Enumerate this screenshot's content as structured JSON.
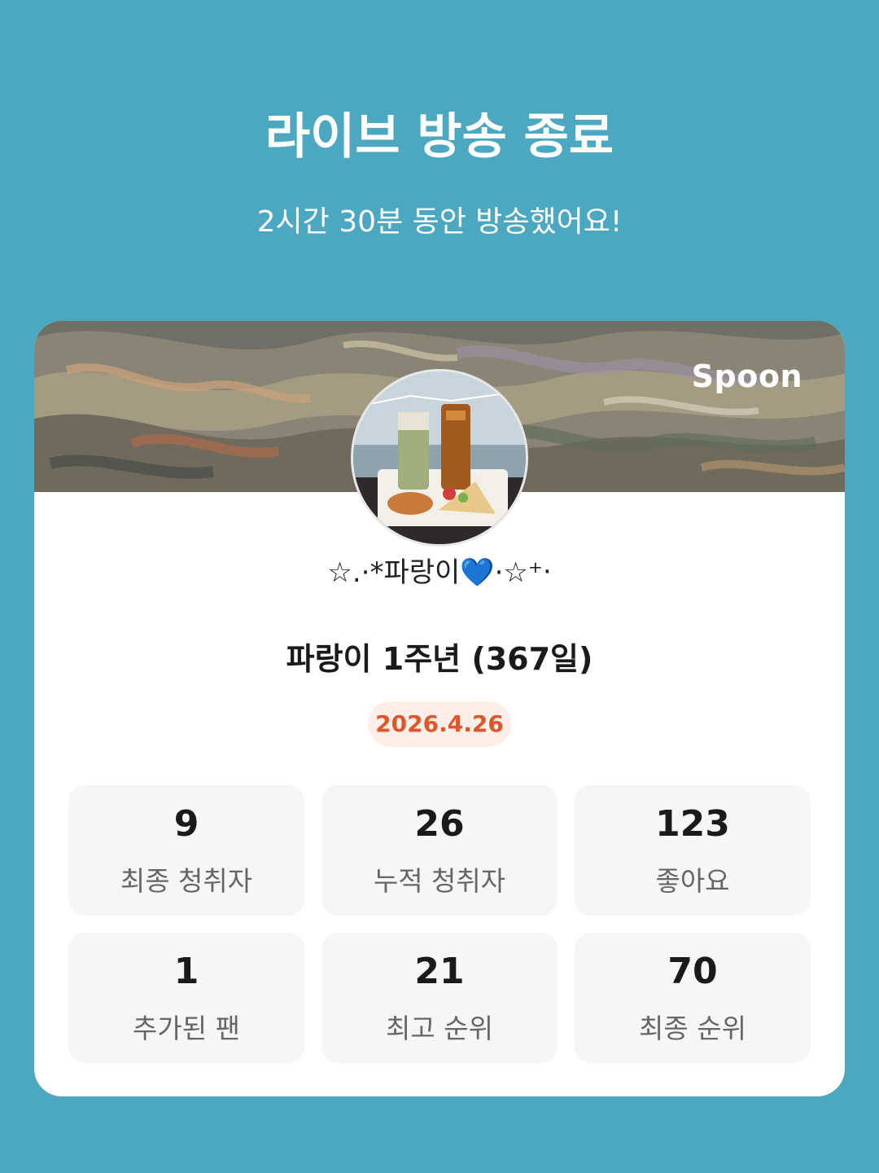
{
  "header": {
    "title": "라이브 방송 종료",
    "subtitle": "2시간 30분 동안 방송했어요!"
  },
  "card": {
    "brand": "Spoon",
    "nickname": "☆.·*파랑이💙·☆⁺‧",
    "broadcast_title": "파랑이 1주년 (367일)",
    "date": "2026.4.26",
    "stats": [
      {
        "value": "9",
        "label": "최종 청취자"
      },
      {
        "value": "26",
        "label": "누적 청취자"
      },
      {
        "value": "123",
        "label": "좋아요"
      },
      {
        "value": "1",
        "label": "추가된 팬"
      },
      {
        "value": "21",
        "label": "최고 순위"
      },
      {
        "value": "70",
        "label": "최종 순위"
      }
    ]
  },
  "colors": {
    "background": "#4ba8c0",
    "date_accent": "#e0562b",
    "date_badge_bg": "#fdeee8"
  }
}
